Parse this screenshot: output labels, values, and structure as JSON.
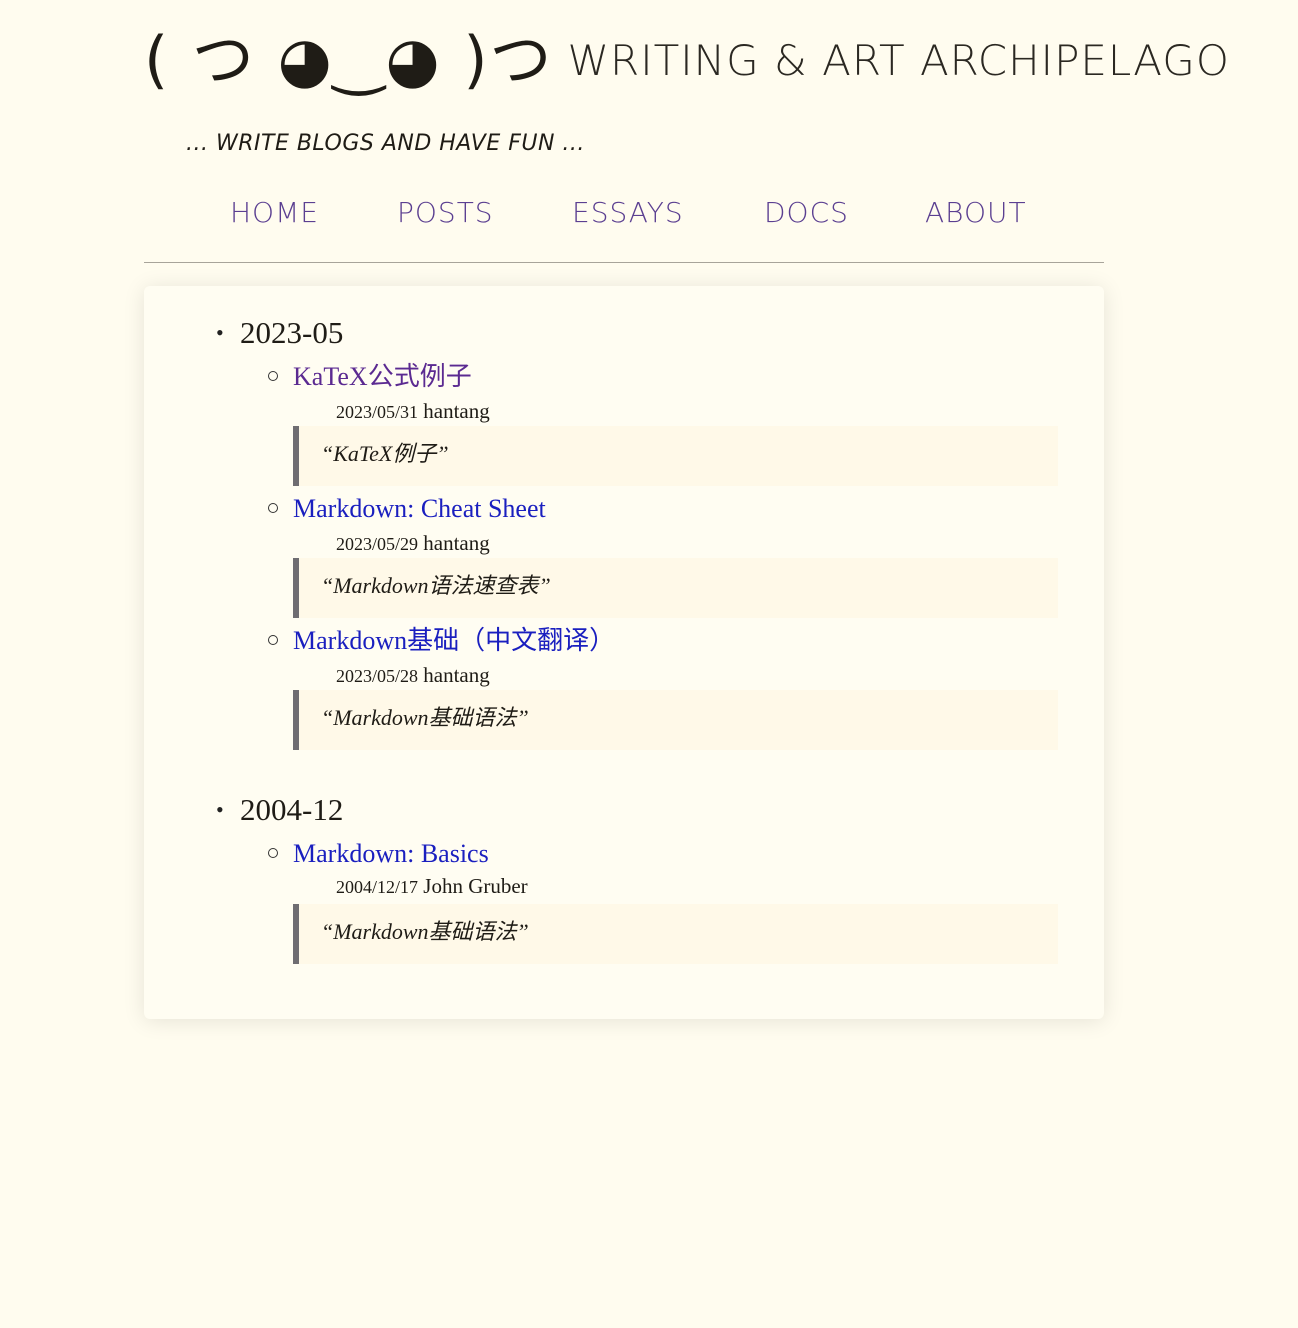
{
  "header": {
    "logo_face": "( つ ◕‿◕ )つ",
    "site_title": "Writing & Art Archipelago",
    "tagline": "... write blogs and have fun ..."
  },
  "nav": {
    "items": [
      {
        "label": "HOME"
      },
      {
        "label": "POSTS"
      },
      {
        "label": "ESSAYS"
      },
      {
        "label": "DOCS"
      },
      {
        "label": "ABOUT"
      }
    ]
  },
  "archive": {
    "years": [
      {
        "label": "2023-05",
        "posts": [
          {
            "title": "KaTeX公式例子",
            "date": "2023/05/31",
            "author": "hantang",
            "excerpt": "“KaTeX例子”",
            "visited": true
          },
          {
            "title": "Markdown: Cheat Sheet",
            "date": "2023/05/29",
            "author": "hantang",
            "excerpt": "“Markdown语法速查表”",
            "visited": false
          },
          {
            "title": "Markdown基础（中文翻译）",
            "date": "2023/05/28",
            "author": "hantang",
            "excerpt": "“Markdown基础语法”",
            "visited": false
          }
        ]
      },
      {
        "label": "2004-12",
        "posts": [
          {
            "title": "Markdown: Basics",
            "date": "2004/12/17",
            "author": "John Gruber",
            "excerpt": "“Markdown基础语法”",
            "visited": false
          }
        ]
      }
    ]
  },
  "colors": {
    "background": "#fffcef",
    "nav_link": "#5b3f91",
    "link": "#1a1fbf",
    "visited_link": "#5b2a91",
    "blockquote_border": "#6f6d72"
  }
}
